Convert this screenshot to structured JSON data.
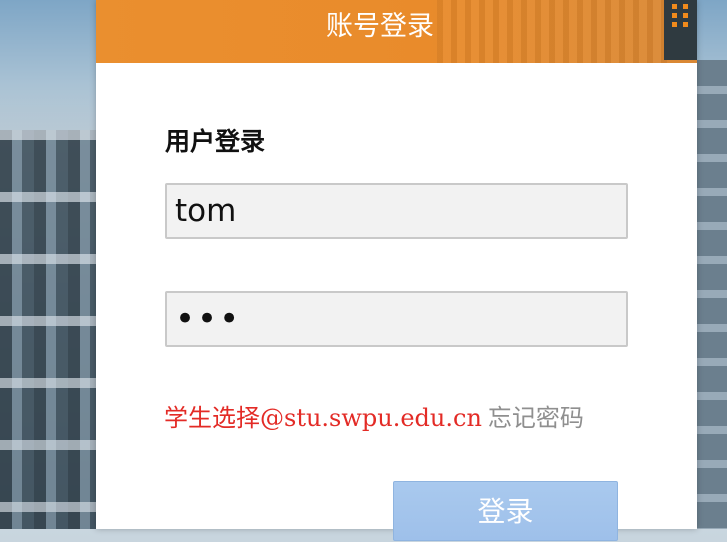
{
  "header": {
    "title": "账号登录",
    "qr_toggle_icon": "grid-dots-icon"
  },
  "form": {
    "heading": "用户登录",
    "username_value": "tom",
    "password_value": "•••",
    "hint_text": "学生选择@stu.swpu.edu.cn",
    "forgot_label": "忘记密码",
    "login_label": "登录"
  },
  "colors": {
    "header_orange": "#ea8f2f",
    "hint_red": "#e32b26",
    "button_blue": "#a9c9ee"
  }
}
